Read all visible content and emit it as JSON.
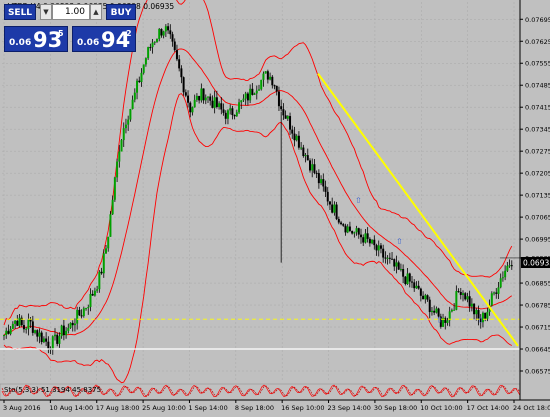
{
  "title": "_VTBR,H4  0.06898 0.06935 0.06898 0.06935",
  "trade_panel": {
    "sell_label": "SELL",
    "buy_label": "BUY",
    "lot_value": "1.00",
    "sell_price_small": "0.06",
    "sell_price_big": "93",
    "sell_price_sup": "5",
    "buy_price_small": "0.06",
    "buy_price_big": "94",
    "buy_price_sup": "2"
  },
  "price_axis": {
    "labels": [
      "0.07695",
      "0.07625",
      "0.07555",
      "0.07485",
      "0.07415",
      "0.07345",
      "0.07275",
      "0.07205",
      "0.07135",
      "0.07065",
      "0.06995",
      "0.06935",
      "0.06855",
      "0.06785",
      "0.06715",
      "0.06645",
      "0.06575"
    ],
    "current_label": "0.06935",
    "current_value": 0.06935,
    "white_line_value": 0.06645
  },
  "time_axis": {
    "labels": [
      "3 Aug 2016",
      "10 Aug 14:00",
      "17 Aug 18:00",
      "25 Aug 10:00",
      "1 Sep 14:00",
      "8 Sep 18:00",
      "16 Sep 10:00",
      "23 Sep 14:00",
      "30 Sep 18:00",
      "10 Oct 10:00",
      "17 Oct 14:00",
      "24 Oct 18:00"
    ]
  },
  "indicator": {
    "label": "Sto(5,3,3) 51.3194 45.8375"
  },
  "colors": {
    "background": "#c0c0c0",
    "grid": "#a8a8a8",
    "bull_body": "#00a000",
    "bear_body": "#000000",
    "bands": "#ff0000",
    "trendline": "#ffff00",
    "level_line": "#ffff00",
    "white_line": "#ffffff",
    "price_tag": "#000000",
    "stoch_main": "#ff0000",
    "stoch_signal": "#c00000",
    "arrow_marks": "#3a5fd0"
  },
  "chart_data": {
    "type": "candlestick",
    "symbol": "_VTBR",
    "timeframe": "H4",
    "ylim": [
      0.0654,
      0.0775
    ],
    "close_path": [
      0.0669,
      0.0672,
      0.0674,
      0.0671,
      0.0673,
      0.067,
      0.0668,
      0.0666,
      0.0667,
      0.067,
      0.0671,
      0.0674,
      0.0676,
      0.0679,
      0.0683,
      0.0688,
      0.0698,
      0.0714,
      0.073,
      0.0738,
      0.0743,
      0.075,
      0.0757,
      0.0762,
      0.0765,
      0.0767,
      0.0762,
      0.0755,
      0.0748,
      0.0741,
      0.0744,
      0.0746,
      0.0744,
      0.0742,
      0.074,
      0.0739,
      0.0741,
      0.0743,
      0.0745,
      0.0748,
      0.075,
      0.0752,
      0.075,
      0.0742,
      0.0738,
      0.0734,
      0.073,
      0.0726,
      0.0722,
      0.0718,
      0.0714,
      0.071,
      0.0707,
      0.0704,
      0.0702,
      0.0701,
      0.07,
      0.0698,
      0.0696,
      0.0694,
      0.0692,
      0.069,
      0.0688,
      0.0686,
      0.0684,
      0.0681,
      0.0679,
      0.0676,
      0.0673,
      0.0675,
      0.0679,
      0.0684,
      0.0681,
      0.0677,
      0.0673,
      0.0676,
      0.0681,
      0.0686,
      0.069,
      0.0693
    ]
  }
}
